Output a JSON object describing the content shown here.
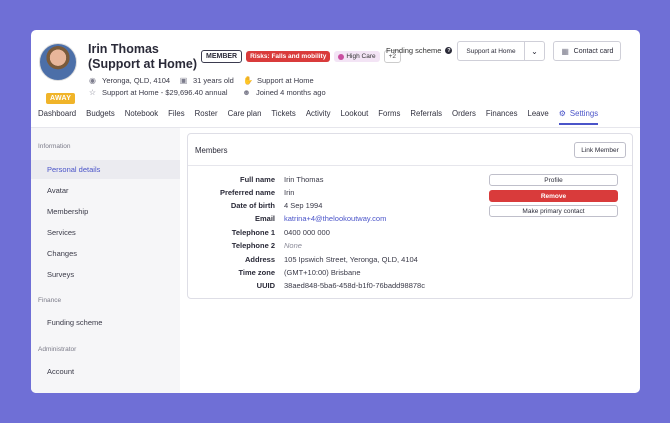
{
  "client": {
    "name": "Irin Thomas (Support at Home)",
    "status": "AWAY",
    "badges": {
      "member": "MEMBER",
      "risk": "Risks: Falls and mobility",
      "care": "High Care",
      "more": "+2"
    },
    "location": "Yeronga, QLD, 4104",
    "age": "31 years old",
    "program": "Support at Home",
    "funding_line": "Support at Home - $29,696.40 annual",
    "joined": "Joined 4 months ago"
  },
  "header": {
    "funding_label": "Funding scheme",
    "funding_value": "Support at Home",
    "contact_card": "Contact card"
  },
  "tabs": [
    "Dashboard",
    "Budgets",
    "Notebook",
    "Files",
    "Roster",
    "Care plan",
    "Tickets",
    "Activity",
    "Lookout",
    "Forms",
    "Referrals",
    "Orders",
    "Finances",
    "Leave",
    "Settings"
  ],
  "sidebar": {
    "sections": [
      {
        "title": "Information",
        "items": [
          "Personal details",
          "Avatar",
          "Membership",
          "Services",
          "Changes",
          "Surveys"
        ]
      },
      {
        "title": "Finance",
        "items": [
          "Funding scheme"
        ]
      },
      {
        "title": "Administrator",
        "items": [
          "Account"
        ]
      }
    ]
  },
  "members": {
    "title": "Members",
    "link_button": "Link Member",
    "fields": [
      {
        "label": "Full name",
        "value": "Irin Thomas"
      },
      {
        "label": "Preferred name",
        "value": "Irin"
      },
      {
        "label": "Date of birth",
        "value": "4 Sep 1994"
      },
      {
        "label": "Email",
        "value": "katrina+4@thelookoutway.com"
      },
      {
        "label": "Telephone 1",
        "value": "0400 000 000"
      },
      {
        "label": "Telephone 2",
        "value": "None"
      },
      {
        "label": "Address",
        "value": "105 Ipswich Street, Yeronga, QLD, 4104"
      },
      {
        "label": "Time zone",
        "value": "(GMT+10:00) Brisbane"
      },
      {
        "label": "UUID",
        "value": "38aed848-5ba6-458d-b1f0-76badd98878c"
      }
    ],
    "actions": {
      "profile": "Profile",
      "remove": "Remove",
      "primary": "Make primary contact"
    }
  },
  "colors": {
    "accent": "#4a54c9",
    "danger": "#d93b3b",
    "away": "#f0b429",
    "background": "#6f6fd6"
  }
}
